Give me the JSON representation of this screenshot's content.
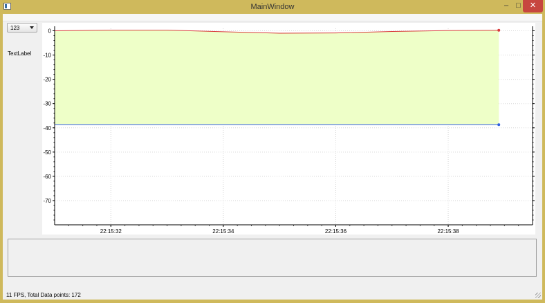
{
  "window": {
    "title": "MainWindow",
    "minimize_glyph": "–",
    "maximize_glyph": "□",
    "close_glyph": "✕"
  },
  "controls": {
    "combo_value": "123",
    "text_label": "TextLabel"
  },
  "status": {
    "text": "11 FPS, Total Data points: 172"
  },
  "colors": {
    "fill_area": "#eeffc8",
    "upper_series": "#d83a3a",
    "lower_series": "#2f5fe0",
    "grid": "#d6d6d6",
    "close_button": "#c7463f",
    "frame": "#cfb95c"
  },
  "chart_data": {
    "type": "area",
    "x_ticks": [
      "22:15:32",
      "22:15:34",
      "22:15:36",
      "22:15:38"
    ],
    "x_range": [
      "22:15:31",
      "22:15:39.5"
    ],
    "ylim": [
      -80,
      1
    ],
    "y_ticks": [
      0,
      -10,
      -20,
      -30,
      -40,
      -50,
      -60,
      -70
    ],
    "grid": true,
    "series": [
      {
        "x": [
          "22:15:31",
          "22:15:32",
          "22:15:33",
          "22:15:34",
          "22:15:35",
          "22:15:36",
          "22:15:37",
          "22:15:38",
          "22:15:38.9"
        ],
        "values": [
          0.0,
          0.3,
          0.3,
          -0.4,
          -1.0,
          -0.9,
          -0.3,
          0.1,
          0.2
        ]
      },
      {
        "x": [
          "22:15:31",
          "22:15:38.9"
        ],
        "values": [
          -38.7,
          -38.7
        ]
      }
    ]
  }
}
